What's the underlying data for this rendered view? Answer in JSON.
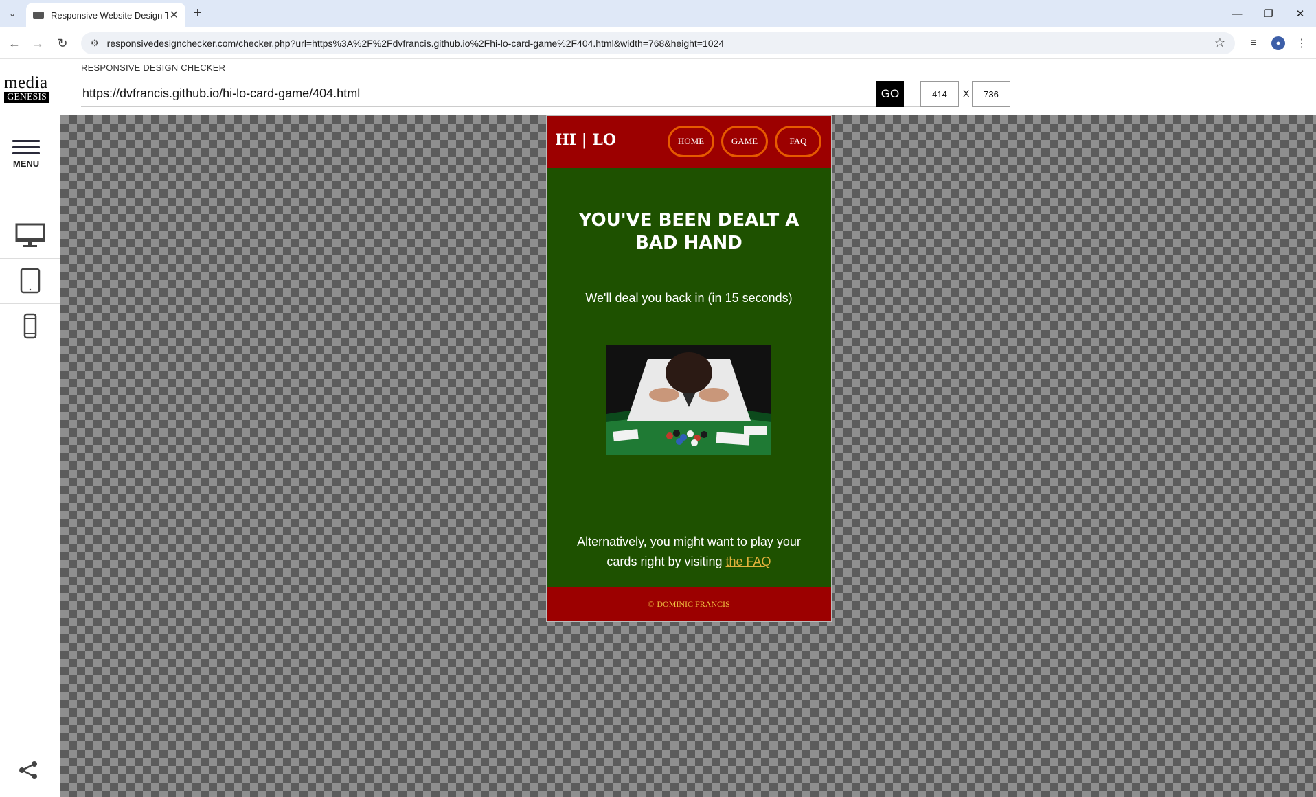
{
  "browser": {
    "tab_title": "Responsive Website Design Tes",
    "url": "responsivedesignchecker.com/checker.php?url=https%3A%2F%2Fdvfrancis.github.io%2Fhi-lo-card-game%2F404.html&width=768&height=1024"
  },
  "checker": {
    "logo_top": "media",
    "logo_bottom": "GENESIS",
    "menu_label": "MENU",
    "title": "RESPONSIVE DESIGN CHECKER",
    "url_value": "https://dvfrancis.github.io/hi-lo-card-game/404.html",
    "go_label": "GO",
    "width_value": "414",
    "x_label": "X",
    "height_value": "736"
  },
  "site": {
    "brand": "HI | LO",
    "nav": [
      "HOME",
      "GAME",
      "FAQ"
    ],
    "heading": "YOU'VE BEEN DEALT A BAD HAND",
    "subtext": "We'll deal you back in (in 15 seconds)",
    "alt_text": "Alternatively, you might want to play your cards right by visiting",
    "faq_link": "the FAQ",
    "footer_copy": "©",
    "footer_link": "DOMINIC FRANCIS"
  },
  "colors": {
    "site_red": "#9c0000",
    "site_green": "#1e5100",
    "nav_pill_border": "#e65a00",
    "link_gold": "#e3b23c"
  }
}
